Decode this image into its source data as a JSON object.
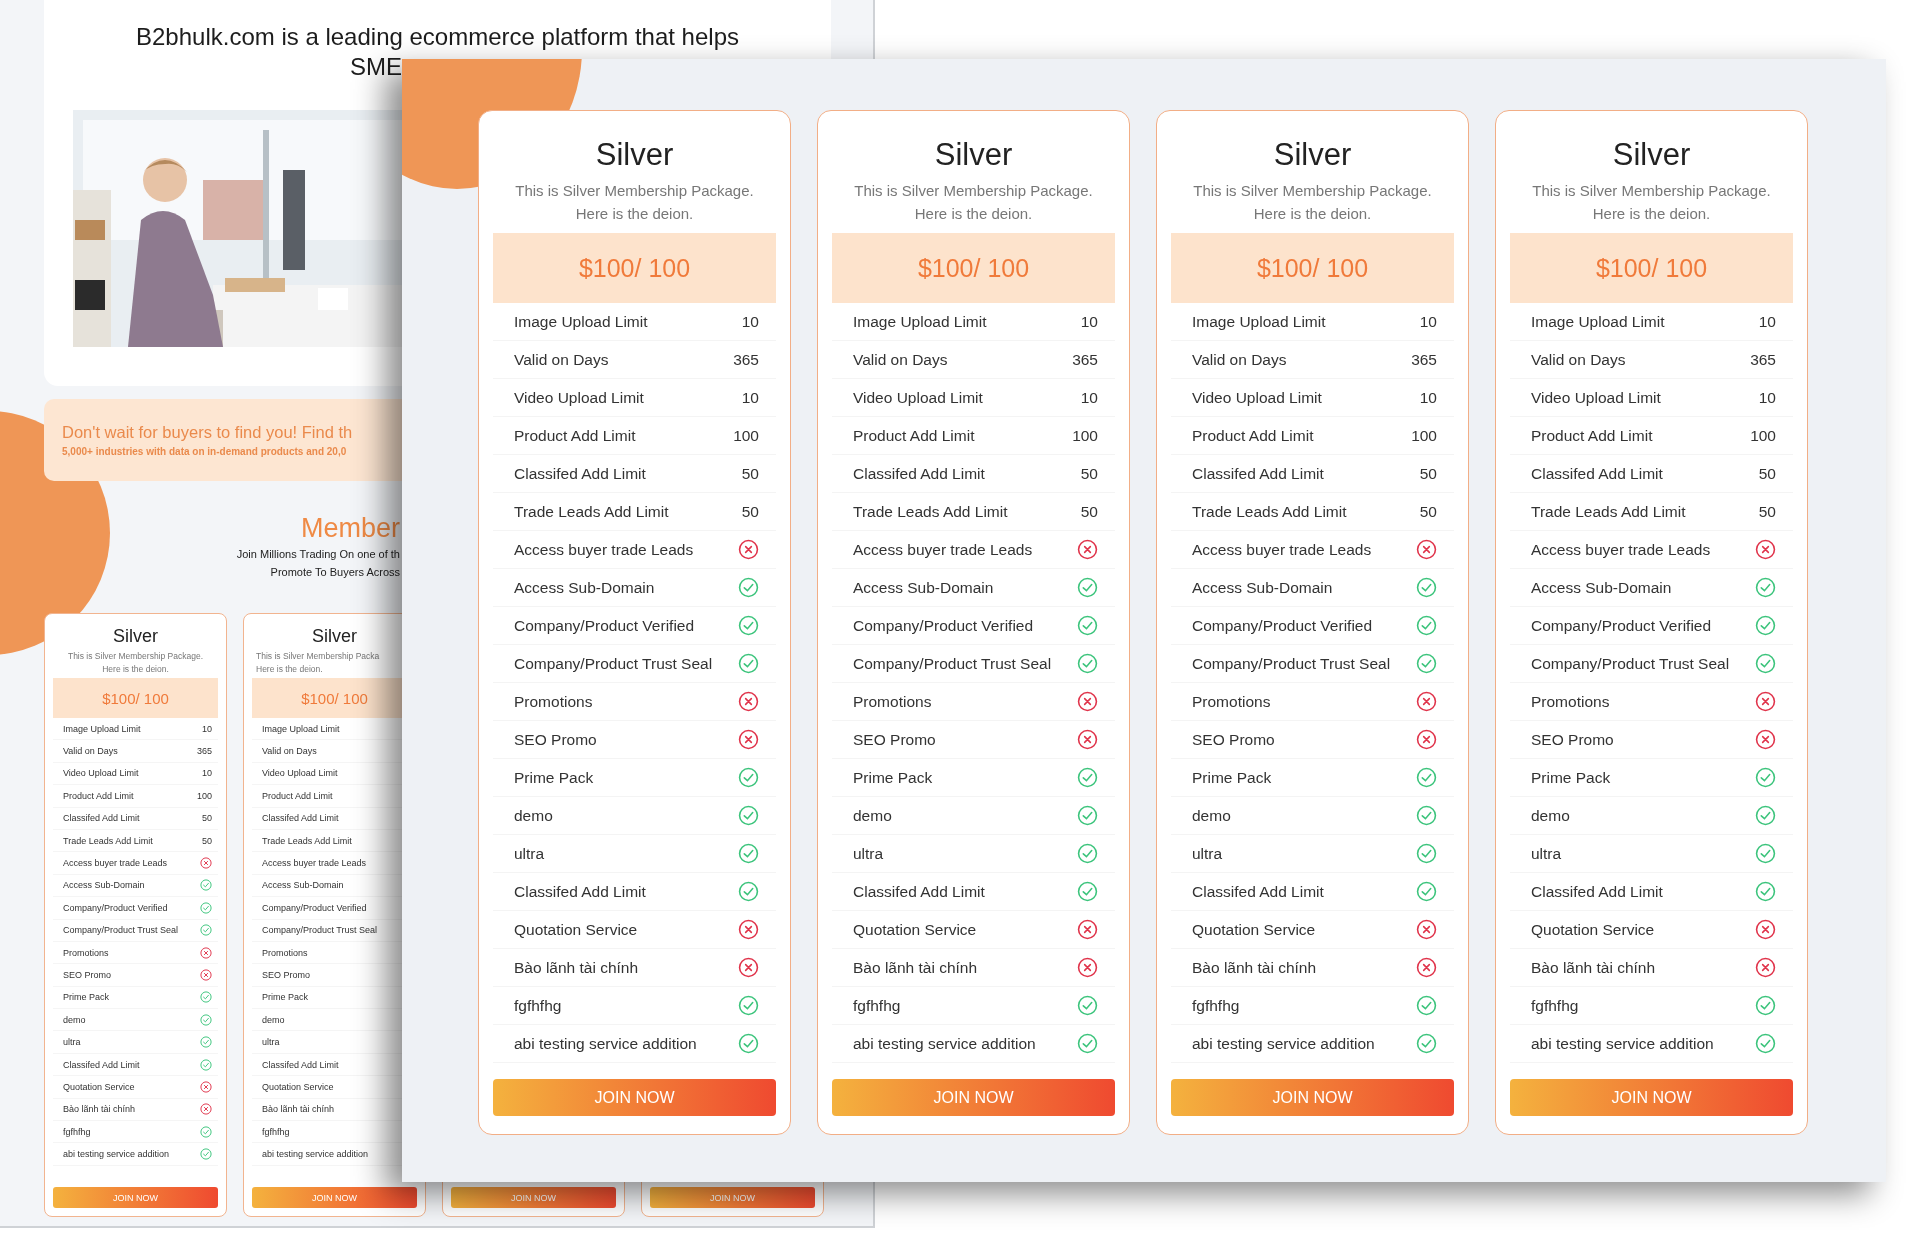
{
  "back_page": {
    "headline": "B2bhulk.com is a leading ecommerce platform that helps",
    "headline_2": "SME",
    "banner": {
      "title": "Don't wait for buyers to find you! Find th",
      "subtitle": "5,000+ industries with data on in-demand products and 20,0"
    },
    "membership": {
      "heading": "Member",
      "lines": [
        "Join Millions Trading On one of th",
        "Promote To Buyers Across"
      ]
    },
    "cards": [
      {
        "title": "Silver",
        "description": [
          "This is Silver Membership Package.",
          "Here is the deion."
        ],
        "price": "$100/ 100",
        "button": "JOIN NOW",
        "features": [
          {
            "label": "Image Upload Limit",
            "kind": "value",
            "value": "10"
          },
          {
            "label": "Valid on Days",
            "kind": "value",
            "value": "365"
          },
          {
            "label": "Video Upload Limit",
            "kind": "value",
            "value": "10"
          },
          {
            "label": "Product Add Limit",
            "kind": "value",
            "value": "100"
          },
          {
            "label": "Classifed Add Limit",
            "kind": "value",
            "value": "50"
          },
          {
            "label": "Trade Leads Add Limit",
            "kind": "value",
            "value": "50"
          },
          {
            "label": "Access buyer trade Leads",
            "kind": "check",
            "included": false
          },
          {
            "label": "Access Sub-Domain",
            "kind": "check",
            "included": true
          },
          {
            "label": "Company/Product Verified",
            "kind": "check",
            "included": true
          },
          {
            "label": "Company/Product Trust Seal",
            "kind": "check",
            "included": true
          },
          {
            "label": "Promotions",
            "kind": "check",
            "included": false
          },
          {
            "label": "SEO Promo",
            "kind": "check",
            "included": false
          },
          {
            "label": "Prime Pack",
            "kind": "check",
            "included": true
          },
          {
            "label": "demo",
            "kind": "check",
            "included": true
          },
          {
            "label": "ultra",
            "kind": "check",
            "included": true
          },
          {
            "label": "Classifed Add Limit",
            "kind": "check",
            "included": true
          },
          {
            "label": "Quotation Service",
            "kind": "check",
            "included": false
          },
          {
            "label": "Bào lãnh tài chính",
            "kind": "check",
            "included": false
          },
          {
            "label": "fgfhfhg",
            "kind": "check",
            "included": true
          },
          {
            "label": "abi testing service addition",
            "kind": "check",
            "included": true
          }
        ]
      },
      {
        "title": "Silver",
        "description": [
          "This is Silver Membership Packa",
          "Here is the deion."
        ],
        "price": "$100/ 100",
        "button": "JOIN NOW",
        "features": [
          {
            "label": "Image Upload Limit"
          },
          {
            "label": "Valid on Days"
          },
          {
            "label": "Video Upload Limit"
          },
          {
            "label": "Product Add Limit"
          },
          {
            "label": "Classifed Add Limit"
          },
          {
            "label": "Trade Leads Add Limit"
          },
          {
            "label": "Access buyer trade Leads"
          },
          {
            "label": "Access Sub-Domain"
          },
          {
            "label": "Company/Product Verified"
          },
          {
            "label": "Company/Product Trust Seal"
          },
          {
            "label": "Promotions"
          },
          {
            "label": "SEO Promo"
          },
          {
            "label": "Prime Pack"
          },
          {
            "label": "demo"
          },
          {
            "label": "ultra"
          },
          {
            "label": "Classifed Add Limit"
          },
          {
            "label": "Quotation Service"
          },
          {
            "label": "Bào lãnh tài chính"
          },
          {
            "label": "fgfhfhg"
          },
          {
            "label": "abi testing service addition"
          }
        ]
      },
      {
        "button": "JOIN NOW"
      },
      {
        "button": "JOIN NOW"
      }
    ]
  },
  "overlay": {
    "cards": [
      {
        "title": "Silver",
        "description": [
          "This is Silver Membership Package.",
          "Here is the deion."
        ],
        "price": "$100/ 100",
        "button": "JOIN NOW",
        "features": [
          {
            "label": "Image Upload Limit",
            "kind": "value",
            "value": "10"
          },
          {
            "label": "Valid on Days",
            "kind": "value",
            "value": "365"
          },
          {
            "label": "Video Upload Limit",
            "kind": "value",
            "value": "10"
          },
          {
            "label": "Product Add Limit",
            "kind": "value",
            "value": "100"
          },
          {
            "label": "Classifed Add Limit",
            "kind": "value",
            "value": "50"
          },
          {
            "label": "Trade Leads Add Limit",
            "kind": "value",
            "value": "50"
          },
          {
            "label": "Access buyer trade Leads",
            "kind": "check",
            "included": false
          },
          {
            "label": "Access Sub-Domain",
            "kind": "check",
            "included": true
          },
          {
            "label": "Company/Product Verified",
            "kind": "check",
            "included": true
          },
          {
            "label": "Company/Product Trust Seal",
            "kind": "check",
            "included": true
          },
          {
            "label": "Promotions",
            "kind": "check",
            "included": false
          },
          {
            "label": "SEO Promo",
            "kind": "check",
            "included": false
          },
          {
            "label": "Prime Pack",
            "kind": "check",
            "included": true
          },
          {
            "label": "demo",
            "kind": "check",
            "included": true
          },
          {
            "label": "ultra",
            "kind": "check",
            "included": true
          },
          {
            "label": "Classifed Add Limit",
            "kind": "check",
            "included": true
          },
          {
            "label": "Quotation Service",
            "kind": "check",
            "included": false
          },
          {
            "label": "Bào lãnh tài chính",
            "kind": "check",
            "included": false
          },
          {
            "label": "fgfhfhg",
            "kind": "check",
            "included": true
          },
          {
            "label": "abi testing service addition",
            "kind": "check",
            "included": true
          }
        ]
      },
      {
        "title": "Silver",
        "description": [
          "This is Silver Membership Package.",
          "Here is the deion."
        ],
        "price": "$100/ 100",
        "button": "JOIN NOW",
        "features": [
          {
            "label": "Image Upload Limit",
            "kind": "value",
            "value": "10"
          },
          {
            "label": "Valid on Days",
            "kind": "value",
            "value": "365"
          },
          {
            "label": "Video Upload Limit",
            "kind": "value",
            "value": "10"
          },
          {
            "label": "Product Add Limit",
            "kind": "value",
            "value": "100"
          },
          {
            "label": "Classifed Add Limit",
            "kind": "value",
            "value": "50"
          },
          {
            "label": "Trade Leads Add Limit",
            "kind": "value",
            "value": "50"
          },
          {
            "label": "Access buyer trade Leads",
            "kind": "check",
            "included": false
          },
          {
            "label": "Access Sub-Domain",
            "kind": "check",
            "included": true
          },
          {
            "label": "Company/Product Verified",
            "kind": "check",
            "included": true
          },
          {
            "label": "Company/Product Trust Seal",
            "kind": "check",
            "included": true
          },
          {
            "label": "Promotions",
            "kind": "check",
            "included": false
          },
          {
            "label": "SEO Promo",
            "kind": "check",
            "included": false
          },
          {
            "label": "Prime Pack",
            "kind": "check",
            "included": true
          },
          {
            "label": "demo",
            "kind": "check",
            "included": true
          },
          {
            "label": "ultra",
            "kind": "check",
            "included": true
          },
          {
            "label": "Classifed Add Limit",
            "kind": "check",
            "included": true
          },
          {
            "label": "Quotation Service",
            "kind": "check",
            "included": false
          },
          {
            "label": "Bào lãnh tài chính",
            "kind": "check",
            "included": false
          },
          {
            "label": "fgfhfhg",
            "kind": "check",
            "included": true
          },
          {
            "label": "abi testing service addition",
            "kind": "check",
            "included": true
          }
        ]
      },
      {
        "title": "Silver",
        "description": [
          "This is Silver Membership Package.",
          "Here is the deion."
        ],
        "price": "$100/ 100",
        "button": "JOIN NOW",
        "features": [
          {
            "label": "Image Upload Limit",
            "kind": "value",
            "value": "10"
          },
          {
            "label": "Valid on Days",
            "kind": "value",
            "value": "365"
          },
          {
            "label": "Video Upload Limit",
            "kind": "value",
            "value": "10"
          },
          {
            "label": "Product Add Limit",
            "kind": "value",
            "value": "100"
          },
          {
            "label": "Classifed Add Limit",
            "kind": "value",
            "value": "50"
          },
          {
            "label": "Trade Leads Add Limit",
            "kind": "value",
            "value": "50"
          },
          {
            "label": "Access buyer trade Leads",
            "kind": "check",
            "included": false
          },
          {
            "label": "Access Sub-Domain",
            "kind": "check",
            "included": true
          },
          {
            "label": "Company/Product Verified",
            "kind": "check",
            "included": true
          },
          {
            "label": "Company/Product Trust Seal",
            "kind": "check",
            "included": true
          },
          {
            "label": "Promotions",
            "kind": "check",
            "included": false
          },
          {
            "label": "SEO Promo",
            "kind": "check",
            "included": false
          },
          {
            "label": "Prime Pack",
            "kind": "check",
            "included": true
          },
          {
            "label": "demo",
            "kind": "check",
            "included": true
          },
          {
            "label": "ultra",
            "kind": "check",
            "included": true
          },
          {
            "label": "Classifed Add Limit",
            "kind": "check",
            "included": true
          },
          {
            "label": "Quotation Service",
            "kind": "check",
            "included": false
          },
          {
            "label": "Bào lãnh tài chính",
            "kind": "check",
            "included": false
          },
          {
            "label": "fgfhfhg",
            "kind": "check",
            "included": true
          },
          {
            "label": "abi testing service addition",
            "kind": "check",
            "included": true
          }
        ]
      },
      {
        "title": "Silver",
        "description": [
          "This is Silver Membership Package.",
          "Here is the deion."
        ],
        "price": "$100/ 100",
        "button": "JOIN NOW",
        "features": [
          {
            "label": "Image Upload Limit",
            "kind": "value",
            "value": "10"
          },
          {
            "label": "Valid on Days",
            "kind": "value",
            "value": "365"
          },
          {
            "label": "Video Upload Limit",
            "kind": "value",
            "value": "10"
          },
          {
            "label": "Product Add Limit",
            "kind": "value",
            "value": "100"
          },
          {
            "label": "Classifed Add Limit",
            "kind": "value",
            "value": "50"
          },
          {
            "label": "Trade Leads Add Limit",
            "kind": "value",
            "value": "50"
          },
          {
            "label": "Access buyer trade Leads",
            "kind": "check",
            "included": false
          },
          {
            "label": "Access Sub-Domain",
            "kind": "check",
            "included": true
          },
          {
            "label": "Company/Product Verified",
            "kind": "check",
            "included": true
          },
          {
            "label": "Company/Product Trust Seal",
            "kind": "check",
            "included": true
          },
          {
            "label": "Promotions",
            "kind": "check",
            "included": false
          },
          {
            "label": "SEO Promo",
            "kind": "check",
            "included": false
          },
          {
            "label": "Prime Pack",
            "kind": "check",
            "included": true
          },
          {
            "label": "demo",
            "kind": "check",
            "included": true
          },
          {
            "label": "ultra",
            "kind": "check",
            "included": true
          },
          {
            "label": "Classifed Add Limit",
            "kind": "check",
            "included": true
          },
          {
            "label": "Quotation Service",
            "kind": "check",
            "included": false
          },
          {
            "label": "Bào lãnh tài chính",
            "kind": "check",
            "included": false
          },
          {
            "label": "fgfhfhg",
            "kind": "check",
            "included": true
          },
          {
            "label": "abi testing service addition",
            "kind": "check",
            "included": true
          }
        ]
      }
    ]
  }
}
